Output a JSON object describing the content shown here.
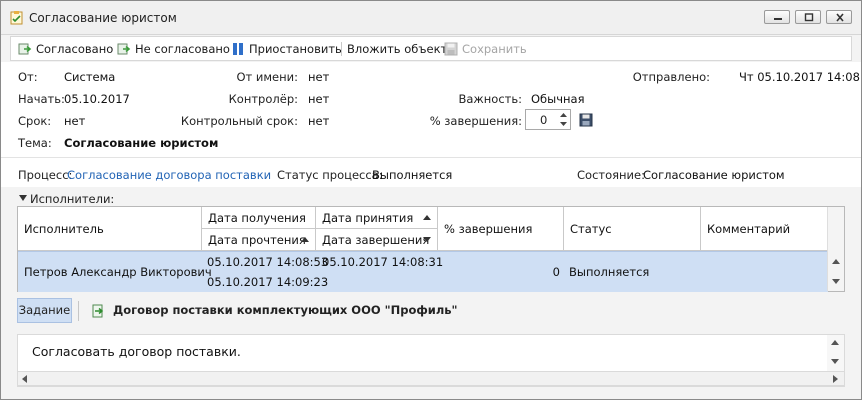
{
  "window": {
    "title": "Согласование юристом",
    "icon": "task-approval-icon"
  },
  "toolbar": {
    "approve_label": "Согласовано",
    "reject_label": "Не согласовано",
    "pause_label": "Приостановить",
    "attach_label": "Вложить объект",
    "save_label": "Сохранить"
  },
  "info": {
    "from_label": "От:",
    "from_value": "Система",
    "start_label": "Начать:",
    "start_value": "05.10.2017",
    "deadline_label": "Срок:",
    "deadline_value": "нет",
    "subject_label": "Тема:",
    "subject_value": "Согласование юристом",
    "on_behalf_label": "От имени:",
    "on_behalf_value": "нет",
    "controller_label": "Контролёр:",
    "controller_value": "нет",
    "control_deadline_label": "Контрольный срок:",
    "control_deadline_value": "нет",
    "importance_label": "Важность:",
    "importance_value": "Обычная",
    "completion_label": "% завершения:",
    "completion_value": "0",
    "sent_label": "Отправлено:",
    "sent_value": "Чт 05.10.2017 14:08"
  },
  "process": {
    "process_label": "Процесс:",
    "process_value": "Согласование договора поставки",
    "status_label": "Статус процесса:",
    "status_value": "Выполняется",
    "state_label": "Состояние:",
    "state_value": "Согласование юристом"
  },
  "executors": {
    "group_label": "Исполнители:",
    "columns": {
      "executor": "Исполнитель",
      "received": "Дата получения",
      "read": "Дата прочтения",
      "accepted": "Дата принятия",
      "completed": "Дата завершения",
      "percent": "% завершения",
      "status": "Статус",
      "comment": "Комментарий"
    },
    "rows": [
      {
        "executor": "Петров Александр Викторович",
        "received": "05.10.2017 14:08:53",
        "read": "05.10.2017 14:09:23",
        "accepted": "05.10.2017 14:08:31",
        "completed": "",
        "percent": "0",
        "status": "Выполняется",
        "comment": ""
      }
    ]
  },
  "task": {
    "tab_label": "Задание",
    "attachment_label": "Договор поставки комплектующих ООО \"Профиль\"",
    "text": "Согласовать договор поставки."
  },
  "colors": {
    "selection": "#cfdff4",
    "link": "#2264b5",
    "approve_green": "#3a9a3a",
    "pause_blue": "#2f6fc9"
  }
}
